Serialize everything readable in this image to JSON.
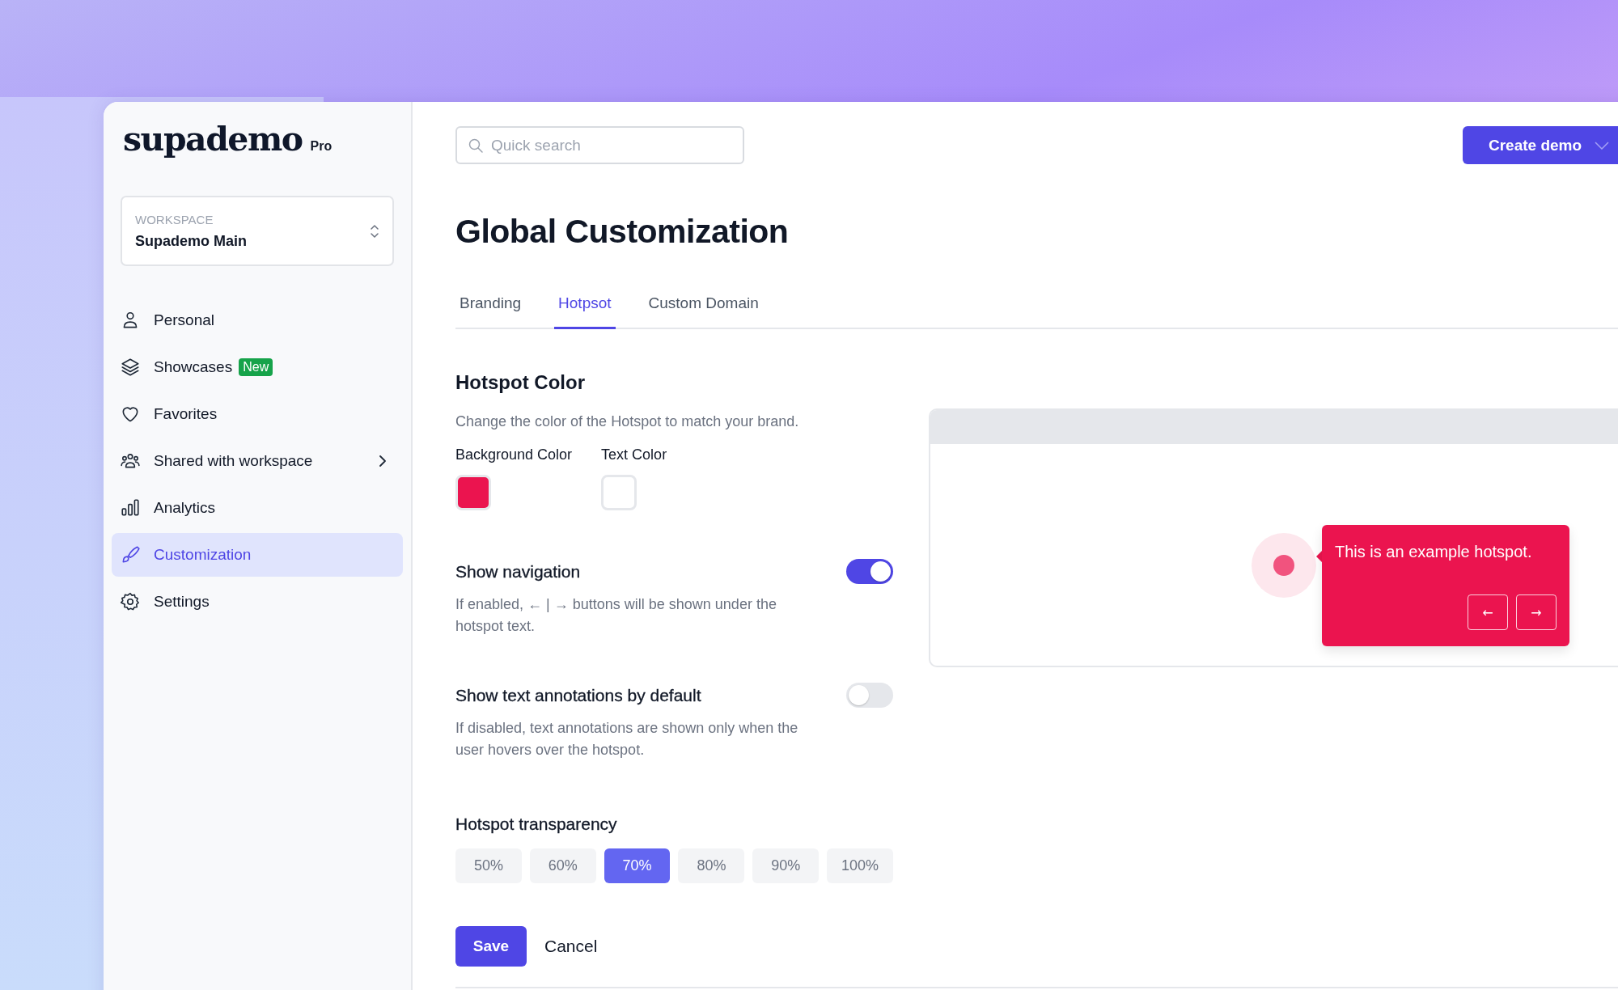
{
  "logo": {
    "name": "supademo",
    "badge": "Pro"
  },
  "workspace": {
    "label": "WORKSPACE",
    "name": "Supademo Main"
  },
  "nav": [
    {
      "label": "Personal",
      "kind": "person",
      "expandable": false,
      "selected": false
    },
    {
      "label": "Showcases",
      "kind": "layers",
      "badge": "New",
      "expandable": false,
      "selected": false
    },
    {
      "label": "Favorites",
      "kind": "heart",
      "expandable": false,
      "selected": false
    },
    {
      "label": "Shared with workspace",
      "kind": "people",
      "expandable": true,
      "selected": false
    },
    {
      "label": "Analytics",
      "kind": "chart",
      "expandable": false,
      "selected": false
    },
    {
      "label": "Customization",
      "kind": "brush",
      "expandable": false,
      "selected": true
    },
    {
      "label": "Settings",
      "kind": "gear",
      "expandable": false,
      "selected": false
    }
  ],
  "search": {
    "placeholder": "Quick search"
  },
  "create_button": "Create demo",
  "title": "Global Customization",
  "tabs": [
    {
      "label": "Branding",
      "selected": false
    },
    {
      "label": "Hotpsot",
      "selected": true
    },
    {
      "label": "Custom Domain",
      "selected": false
    }
  ],
  "hotspot_color": {
    "heading": "Hotspot Color",
    "description": "Change the color of the Hotspot to match your brand.",
    "fields": [
      {
        "label": "Background Color",
        "color": "#eb144f"
      },
      {
        "label": "Text Color",
        "color": "#ffffff"
      }
    ]
  },
  "toggles": [
    {
      "label": "Show navigation",
      "description": "If enabled, ← | → buttons will be shown under the hotspot text.",
      "on": true
    },
    {
      "label": "Show text annotations by default",
      "description": "If disabled, text annotations are shown only when the user hovers over the hotspot.",
      "on": false
    }
  ],
  "transparency": {
    "heading": "Hotspot transparency",
    "options": [
      {
        "label": "50%",
        "selected": false
      },
      {
        "label": "60%",
        "selected": false
      },
      {
        "label": "70%",
        "selected": true
      },
      {
        "label": "80%",
        "selected": false
      },
      {
        "label": "90%",
        "selected": false
      },
      {
        "label": "100%",
        "selected": false
      }
    ]
  },
  "actions": {
    "save": "Save",
    "cancel": "Cancel"
  },
  "preview": {
    "text": "This is an example hotspot.",
    "buttons": [
      "←",
      "→"
    ]
  }
}
